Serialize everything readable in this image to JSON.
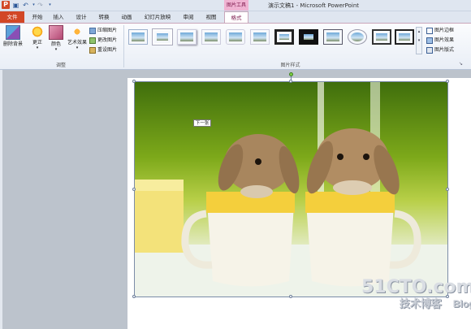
{
  "title_bar": {
    "app_letter": "P",
    "context_tools_label": "图片工具",
    "window_title": "演示文稿1 - Microsoft PowerPoint"
  },
  "tabs": [
    {
      "label": "文件",
      "active": false
    },
    {
      "label": "开始",
      "active": false
    },
    {
      "label": "插入",
      "active": false
    },
    {
      "label": "设计",
      "active": false
    },
    {
      "label": "转换",
      "active": false
    },
    {
      "label": "动画",
      "active": false
    },
    {
      "label": "幻灯片放映",
      "active": false
    },
    {
      "label": "审阅",
      "active": false
    },
    {
      "label": "视图",
      "active": false
    },
    {
      "label": "格式",
      "active": true
    }
  ],
  "ribbon": {
    "adjust_group": {
      "label": "调整",
      "remove_background": "删除背景",
      "corrections": "更正",
      "color": "颜色",
      "artistic_effects": "艺术效果",
      "compress": "压缩图片",
      "change": "更改图片",
      "reset": "重设图片"
    },
    "styles_group": {
      "label": "图片样式",
      "border": "图片边框",
      "effects": "图片效果",
      "layout": "图片版式"
    }
  },
  "tooltip": "下一张",
  "watermark": {
    "line1": "51CTO.com",
    "line2": "技术博客",
    "blog": "Blog"
  },
  "colors": {
    "file_tab": "#d24726",
    "context_tab": "#f0b3d2",
    "ribbon_bg": "#f3f6fb",
    "workspace": "#bcc3cc"
  }
}
